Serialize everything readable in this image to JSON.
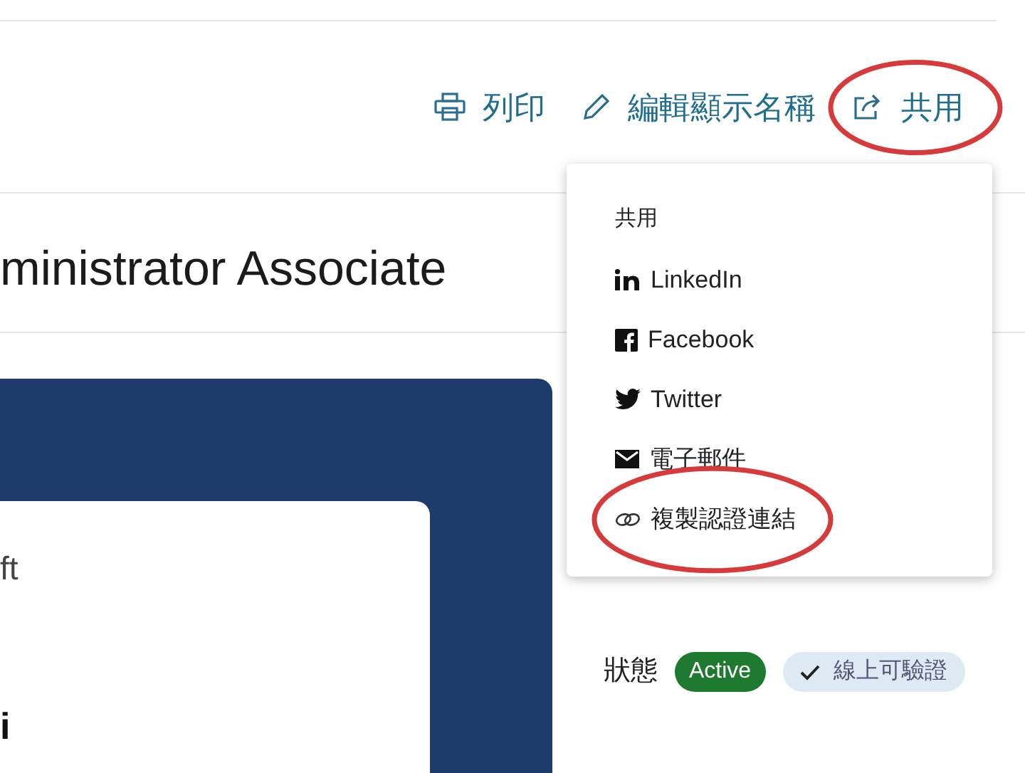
{
  "actions": [
    {
      "kind": "print",
      "label": "列印",
      "circled": false
    },
    {
      "kind": "edit",
      "label": "編輯顯示名稱",
      "circled": false
    },
    {
      "kind": "share",
      "label": "共用",
      "circled": true
    }
  ],
  "title": "ministrator Associate",
  "certificate_card": {
    "issuer_fragment": "ft",
    "name_fragment": "i"
  },
  "share_menu": {
    "heading": "共用",
    "items": [
      {
        "kind": "linkedin",
        "label": "LinkedIn",
        "circled": false
      },
      {
        "kind": "facebook",
        "label": "Facebook",
        "circled": false
      },
      {
        "kind": "twitter",
        "label": "Twitter",
        "circled": false
      },
      {
        "kind": "email",
        "label": "電子郵件",
        "circled": false
      },
      {
        "kind": "link",
        "label": "複製認證連結",
        "circled": true
      }
    ]
  },
  "status": {
    "label": "狀態",
    "badges": [
      {
        "kind": "active",
        "text": "Active"
      },
      {
        "kind": "verified",
        "text": "線上可驗證"
      }
    ]
  }
}
